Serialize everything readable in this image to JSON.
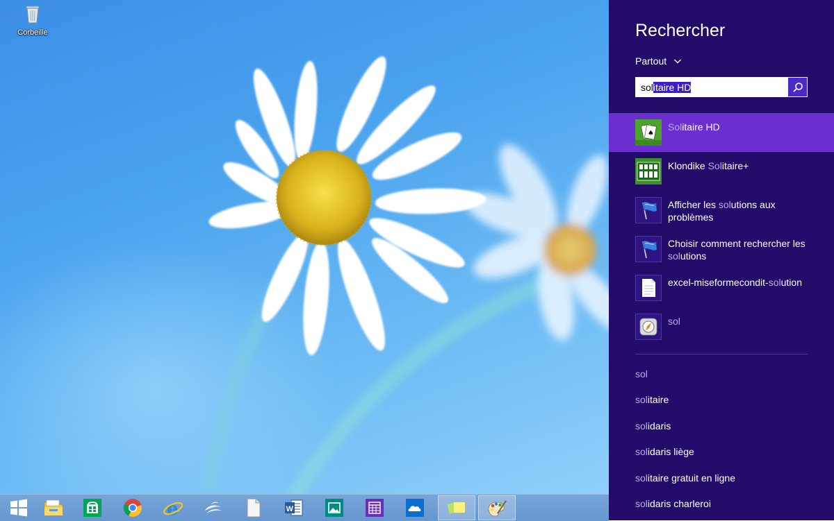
{
  "desktop": {
    "recycle_bin_label": "Corbeille"
  },
  "taskbar": {
    "apps": [
      {
        "name": "start-icon"
      },
      {
        "name": "file-explorer-icon"
      },
      {
        "name": "store-icon"
      },
      {
        "name": "chrome-icon"
      },
      {
        "name": "internet-explorer-icon"
      },
      {
        "name": "openoffice-icon"
      },
      {
        "name": "libreoffice-icon"
      },
      {
        "name": "word-icon"
      },
      {
        "name": "photos-icon"
      },
      {
        "name": "calendar-icon"
      },
      {
        "name": "onedrive-icon"
      },
      {
        "name": "sticky-notes-icon",
        "active": true
      },
      {
        "name": "paint-icon",
        "active": true
      }
    ]
  },
  "search": {
    "title": "Rechercher",
    "scope": "Partout",
    "query_typed": "sol",
    "query_autocomplete": "itaire HD",
    "colors": {
      "panel": "#230c69",
      "selected": "#6b2fd0",
      "accent": "#4a2bc9"
    },
    "results": [
      {
        "match": "Sol",
        "rest": "itaire HD",
        "icon": "solitaire-hd-icon",
        "selected": true
      },
      {
        "prefix": "Klondike ",
        "match": "Sol",
        "rest": "itaire+",
        "icon": "klondike-solitaire-icon"
      },
      {
        "prefix": "Afficher les ",
        "match": "sol",
        "rest": "utions aux problèmes",
        "icon": "action-center-flag-icon"
      },
      {
        "prefix": "Choisir comment rechercher les ",
        "match": "sol",
        "rest": "utions",
        "icon": "action-center-flag-icon"
      },
      {
        "prefix": "excel-miseformecondit-",
        "match": "sol",
        "rest": "ution",
        "icon": "document-icon"
      },
      {
        "prefix": "",
        "match": "sol",
        "rest": "",
        "icon": "compass-app-icon"
      }
    ],
    "suggestions": [
      {
        "match": "sol",
        "rest": ""
      },
      {
        "match": "sol",
        "rest": "itaire"
      },
      {
        "match": "sol",
        "rest": "idaris"
      },
      {
        "match": "sol",
        "rest": "idaris liège"
      },
      {
        "match": "sol",
        "rest": "itaire gratuit en ligne"
      },
      {
        "match": "sol",
        "rest": "idaris charleroi"
      }
    ]
  }
}
